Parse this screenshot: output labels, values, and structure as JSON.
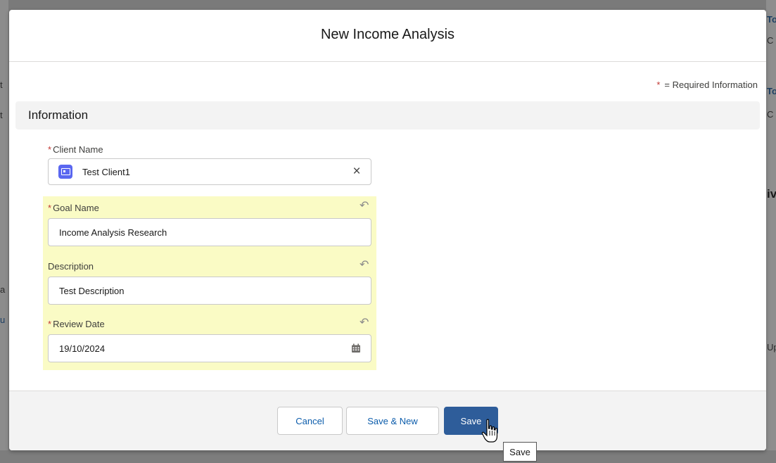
{
  "modal": {
    "title": "New Income Analysis",
    "required_note": "= Required Information",
    "required_star": "*",
    "section_title": "Information"
  },
  "fields": {
    "client_name": {
      "label": "Client Name",
      "value": "Test Client1",
      "required": true,
      "icon": "contact-card-icon"
    },
    "goal_name": {
      "label": "Goal Name",
      "value": "Income Analysis Research",
      "required": true
    },
    "description": {
      "label": "Description",
      "value": "Test Description",
      "required": false
    },
    "review_date": {
      "label": "Review Date",
      "value": "19/10/2024",
      "required": true,
      "icon": "calendar-icon"
    }
  },
  "footer": {
    "cancel_label": "Cancel",
    "save_new_label": "Save & New",
    "save_label": "Save"
  },
  "tooltip": {
    "text": "Save"
  },
  "colors": {
    "brand": "#2e5d9a",
    "required": "#c23934",
    "highlight": "#fafbc5",
    "link": "#0b5cab",
    "lookup_badge": "#5a67f0"
  },
  "background_fragments": {
    "right": [
      "To",
      "C",
      "To",
      "C",
      "iv",
      "Up"
    ],
    "left": [
      "t",
      "t",
      "a",
      "u"
    ]
  }
}
